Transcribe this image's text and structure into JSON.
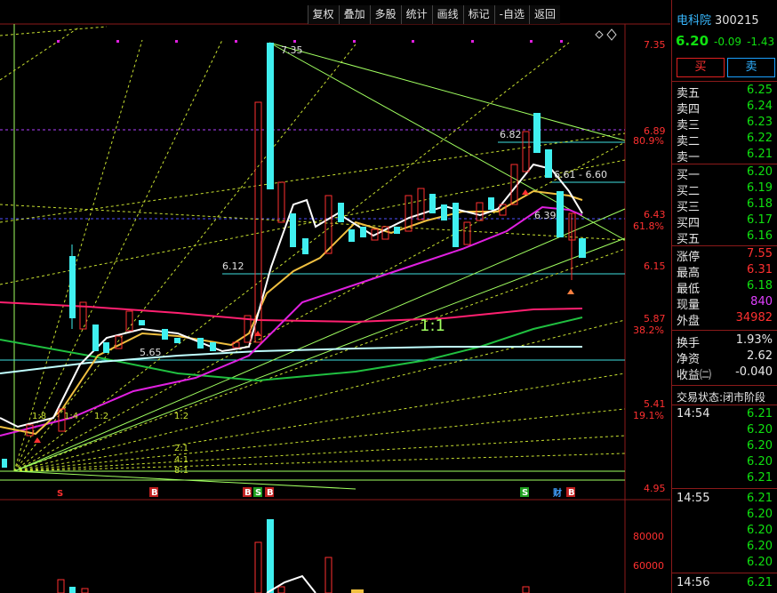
{
  "toolbar": {
    "items": [
      "复权",
      "叠加",
      "多股",
      "统计",
      "画线",
      "标记",
      "-自选",
      "返回"
    ]
  },
  "chart_labels": {
    "price_axis": [
      "7.35",
      "6.89",
      "6.43",
      "6.15",
      "5.87",
      "5.41",
      "4.95"
    ],
    "pct_axis": [
      "80.9%",
      "61.8%",
      "38.2%",
      "19.1%"
    ],
    "volume_axis": [
      "80000",
      "60000"
    ],
    "annotations": [
      "7.35",
      "6.82",
      "6.61 - 6.60",
      "6.39",
      "6.12",
      "5.65",
      "1:1",
      "1:2",
      "2:1",
      "4:1",
      "8:1",
      "1:8",
      "1:4"
    ],
    "ratio_label": "1:1",
    "markers": [
      "S",
      "B",
      "B",
      "S",
      "B",
      "S",
      "财",
      "B"
    ]
  },
  "stock": {
    "name": "电科院",
    "code": "300215",
    "price": "6.20",
    "change": "-0.09",
    "pct": "-1.43"
  },
  "buttons": {
    "buy": "买",
    "sell": "卖"
  },
  "asks": [
    {
      "label": "卖五",
      "value": "6.25"
    },
    {
      "label": "卖四",
      "value": "6.24"
    },
    {
      "label": "卖三",
      "value": "6.23"
    },
    {
      "label": "卖二",
      "value": "6.22"
    },
    {
      "label": "卖一",
      "value": "6.21"
    }
  ],
  "bids": [
    {
      "label": "买一",
      "value": "6.20"
    },
    {
      "label": "买二",
      "value": "6.19"
    },
    {
      "label": "买三",
      "value": "6.18"
    },
    {
      "label": "买四",
      "value": "6.17"
    },
    {
      "label": "买五",
      "value": "6.16"
    }
  ],
  "stats": [
    {
      "label": "涨停",
      "value": "7.55",
      "color": "#ff3030"
    },
    {
      "label": "最高",
      "value": "6.31",
      "color": "#ff3030"
    },
    {
      "label": "最低",
      "value": "6.18",
      "color": "#10e010"
    },
    {
      "label": "现量",
      "value": "840",
      "color": "#e040ff"
    },
    {
      "label": "外盘",
      "value": "34982",
      "color": "#ff3030"
    }
  ],
  "fundamentals": [
    {
      "label": "换手",
      "value": "1.93%",
      "color": "#e8e8e8"
    },
    {
      "label": "净资",
      "value": "2.62",
      "color": "#e8e8e8"
    },
    {
      "label": "收益㈡",
      "value": "-0.040",
      "color": "#e8e8e8"
    }
  ],
  "trade_status": {
    "label": "交易状态:",
    "value": "闭市阶段"
  },
  "ticks": [
    {
      "time": "14:54",
      "price": "6.21"
    },
    {
      "time": "",
      "price": "6.20"
    },
    {
      "time": "",
      "price": "6.20"
    },
    {
      "time": "",
      "price": "6.20"
    },
    {
      "time": "",
      "price": "6.21"
    },
    {
      "time": "14:55",
      "price": "6.21"
    },
    {
      "time": "",
      "price": "6.20"
    },
    {
      "time": "",
      "price": "6.20"
    },
    {
      "time": "",
      "price": "6.20"
    },
    {
      "time": "",
      "price": "6.20"
    },
    {
      "time": "14:56",
      "price": "6.21"
    }
  ],
  "colors": {
    "up": "#ff3030",
    "down": "#40f0f0",
    "down_panel": "#10e010",
    "accent": "#38b9ff",
    "divider": "#8b1a1a"
  }
}
